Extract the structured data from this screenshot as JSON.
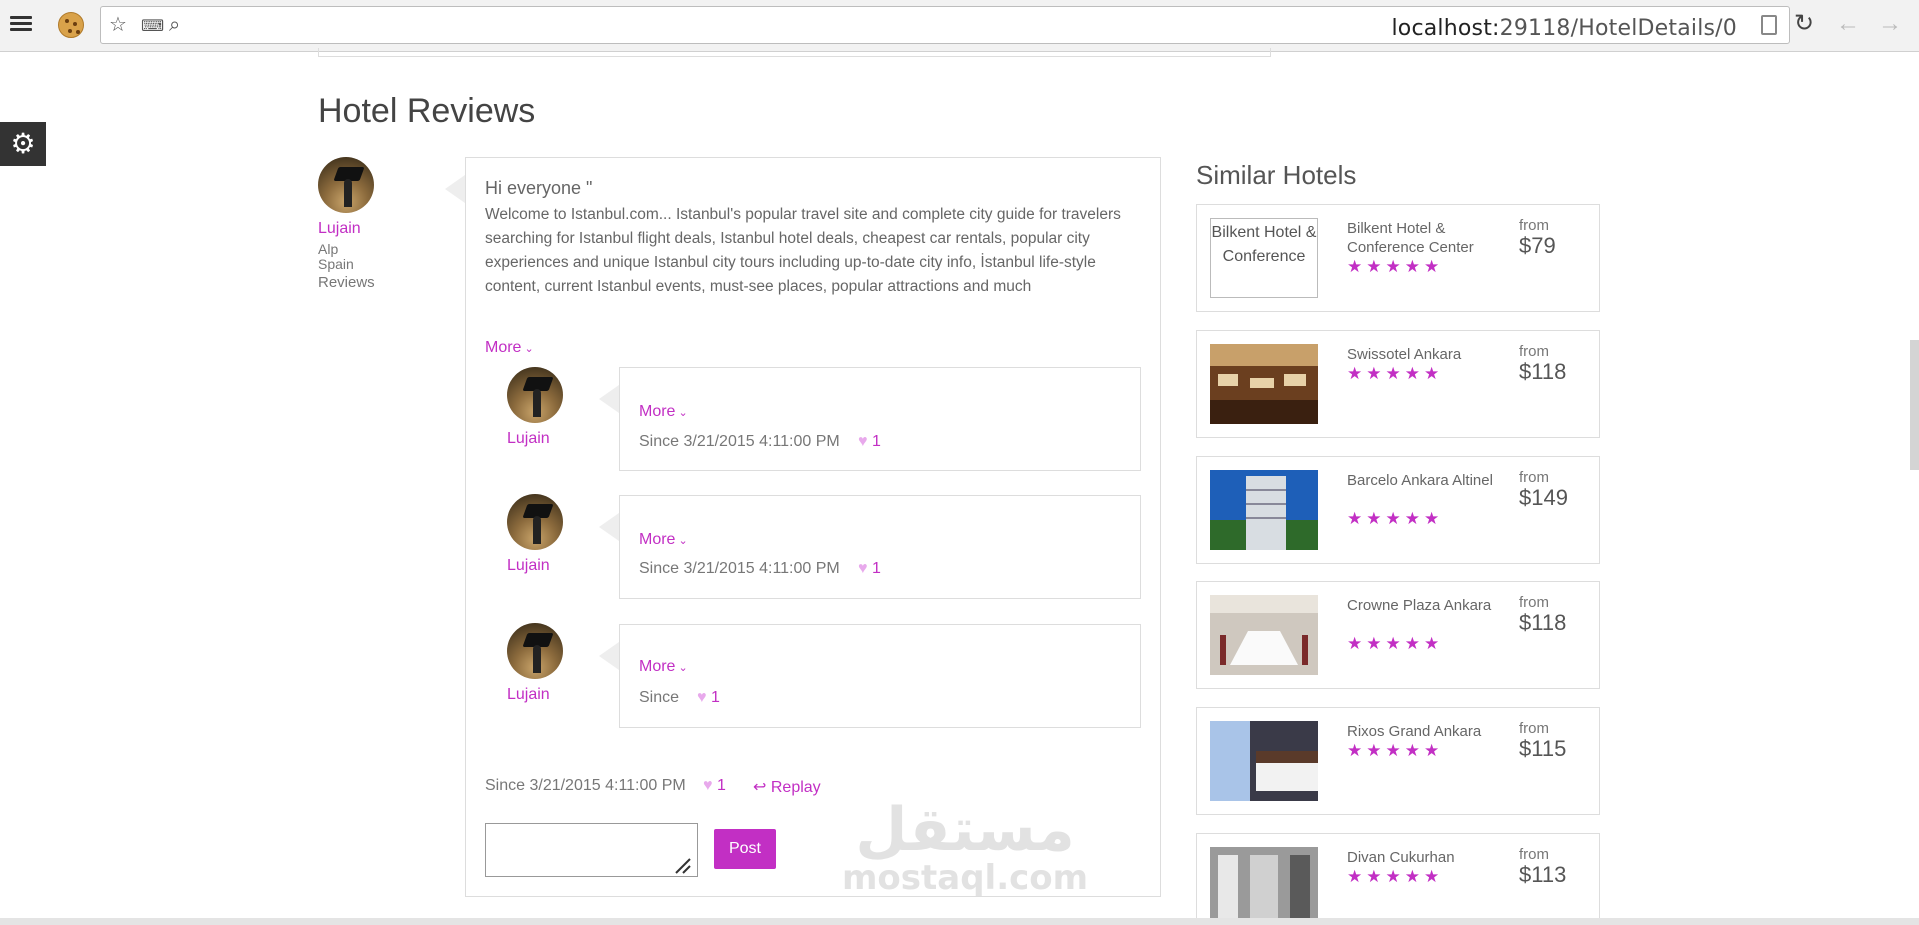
{
  "browser": {
    "url_host": "localhost:",
    "url_rest": "29118/HotelDetails/0"
  },
  "page": {
    "section_title": "Hotel Reviews",
    "similar_title": "Similar Hotels"
  },
  "review": {
    "reviewer_name": "Lujain",
    "reviewer_line1": "Alp",
    "reviewer_line2": "Spain",
    "reviewer_link": "Reviews",
    "title": "Hi everyone \"",
    "body": "Welcome to Istanbul.com... Istanbul's popular travel site and complete city guide for travelers searching for Istanbul flight deals, Istanbul hotel deals, cheapest car rentals, popular city experiences and unique Istanbul city tours including up-to-date city info, İstanbul life-style content, current Istanbul events, must-see places, popular attractions and much",
    "more_label": "More",
    "since": "Since 3/21/2015 4:11:00 PM",
    "likes": "1",
    "replay_label": "Replay",
    "post_label": "Post"
  },
  "replies": [
    {
      "name": "Lujain",
      "more_label": "More",
      "since": "Since 3/21/2015 4:11:00 PM",
      "likes": "1"
    },
    {
      "name": "Lujain",
      "more_label": "More",
      "since": "Since 3/21/2015 4:11:00 PM",
      "likes": "1"
    },
    {
      "name": "Lujain",
      "more_label": "More",
      "since": "Since",
      "likes": "1"
    }
  ],
  "similar_hotels": [
    {
      "name": "Bilkent Hotel & Conference Center",
      "alt": "Bilkent Hotel & Conference",
      "from": "from",
      "price": "$79",
      "stars": "★★★★★"
    },
    {
      "name": "Swissotel Ankara",
      "from": "from",
      "price": "$118",
      "stars": "★★★★★"
    },
    {
      "name": "Barcelo Ankara Altinel",
      "from": "from",
      "price": "$149",
      "stars": "★★★★★"
    },
    {
      "name": "Crowne Plaza Ankara",
      "from": "from",
      "price": "$118",
      "stars": "★★★★★"
    },
    {
      "name": "Rixos Grand Ankara",
      "from": "from",
      "price": "$115",
      "stars": "★★★★★"
    },
    {
      "name": "Divan Cukurhan",
      "from": "from",
      "price": "$113",
      "stars": "★★★★★"
    }
  ],
  "watermark": {
    "arabic": "مستقل",
    "latin": "mostaql.com"
  },
  "colors": {
    "accent": "#c22fc4",
    "heart": "#e8a9ec"
  }
}
